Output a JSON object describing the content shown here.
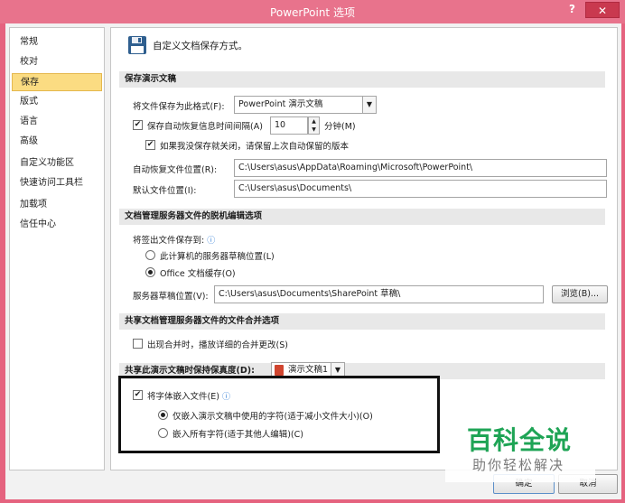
{
  "window": {
    "title": "PowerPoint 选项",
    "help": "?",
    "close": "✕"
  },
  "sidebar": {
    "items": [
      {
        "label": "常规"
      },
      {
        "label": "校对"
      },
      {
        "label": "保存",
        "selected": true
      },
      {
        "label": "版式"
      },
      {
        "label": "语言"
      },
      {
        "label": "高级"
      },
      {
        "label": "自定义功能区"
      },
      {
        "label": "快速访问工具栏"
      },
      {
        "label": "加载项"
      },
      {
        "label": "信任中心"
      }
    ]
  },
  "header": {
    "icon": "floppy-disk-icon",
    "text": "自定义文档保存方式。"
  },
  "save_presentations": {
    "section_title": "保存演示文稿",
    "format_label": "将文件保存为此格式(F):",
    "format_value": "PowerPoint 演示文稿",
    "autorecover_label": "保存自动恢复信息时间间隔(A)",
    "autorecover_checked": true,
    "autorecover_minutes": "10",
    "minutes_label": "分钟(M)",
    "keep_last_label": "如果我没保存就关闭，请保留上次自动保留的版本",
    "keep_last_checked": true,
    "autorecover_location_label": "自动恢复文件位置(R):",
    "autorecover_location_value": "C:\\Users\\asus\\AppData\\Roaming\\Microsoft\\PowerPoint\\",
    "default_location_label": "默认文件位置(I):",
    "default_location_value": "C:\\Users\\asus\\Documents\\"
  },
  "offline_editing": {
    "section_title": "文档管理服务器文件的脱机编辑选项",
    "save_checked_out_label": "将签出文件保存到:",
    "option_server_drafts": "此计算机的服务器草稿位置(L)",
    "option_office_cache": "Office 文档缓存(O)",
    "selected_option": "office_cache",
    "server_drafts_label": "服务器草稿位置(V):",
    "server_drafts_value": "C:\\Users\\asus\\Documents\\SharePoint 草稿\\",
    "browse_label": "浏览(B)..."
  },
  "merge": {
    "section_title": "共享文档管理服务器文件的文件合并选项",
    "show_merge_label": "出现合并时，播放详细的合并更改(S)",
    "show_merge_checked": false
  },
  "fidelity": {
    "section_title": "共享此演示文稿时保持保真度(D):",
    "presentation_value": "演示文稿1",
    "embed_fonts_label": "将字体嵌入文件(E)",
    "embed_fonts_checked": true,
    "option_used_chars": "仅嵌入演示文稿中使用的字符(适于减小文件大小)(O)",
    "option_all_chars": "嵌入所有字符(适于其他人编辑)(C)",
    "selected_option": "used_chars"
  },
  "footer": {
    "ok_label": "确定",
    "cancel_label": "取消"
  },
  "watermark": {
    "title": "百科全说",
    "subtitle": "助你轻松解决"
  }
}
